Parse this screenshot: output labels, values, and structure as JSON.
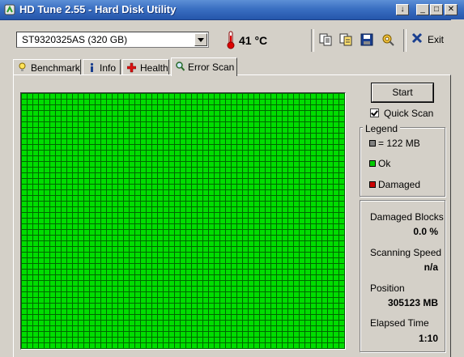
{
  "window": {
    "title": "HD Tune 2.55 - Hard Disk Utility",
    "controls": {
      "minimize": "_",
      "maximize": "□",
      "close": "✕",
      "help": "↓"
    }
  },
  "toolbar": {
    "drive": "ST9320325AS (320 GB)",
    "temperature": "41 °C",
    "exit_label": "Exit",
    "icons": [
      "copy-icon",
      "copy-info-icon",
      "save-icon",
      "options-icon"
    ]
  },
  "tabs": [
    {
      "label": "Benchmark",
      "icon": "lightbulb-icon"
    },
    {
      "label": "Info",
      "icon": "info-icon"
    },
    {
      "label": "Health",
      "icon": "health-cross-icon"
    },
    {
      "label": "Error Scan",
      "icon": "magnifier-icon",
      "active": true
    }
  ],
  "error_scan": {
    "start_label": "Start",
    "quick_scan_label": "Quick Scan",
    "quick_scan_checked": true,
    "legend": {
      "title": "Legend",
      "items": [
        {
          "label": "= 122 MB",
          "color": "#808080"
        },
        {
          "label": "Ok",
          "color": "#00cc00"
        },
        {
          "label": "Damaged",
          "color": "#cc0000"
        }
      ]
    },
    "stats": {
      "damaged_blocks_label": "Damaged Blocks",
      "damaged_blocks_value": "0.0 %",
      "scanning_speed_label": "Scanning Speed",
      "scanning_speed_value": "n/a",
      "position_label": "Position",
      "position_value": "305123 MB",
      "elapsed_label": "Elapsed Time",
      "elapsed_value": "1:10"
    },
    "grid": {
      "block_color": "#00dd00",
      "line_color": "#006600"
    }
  }
}
